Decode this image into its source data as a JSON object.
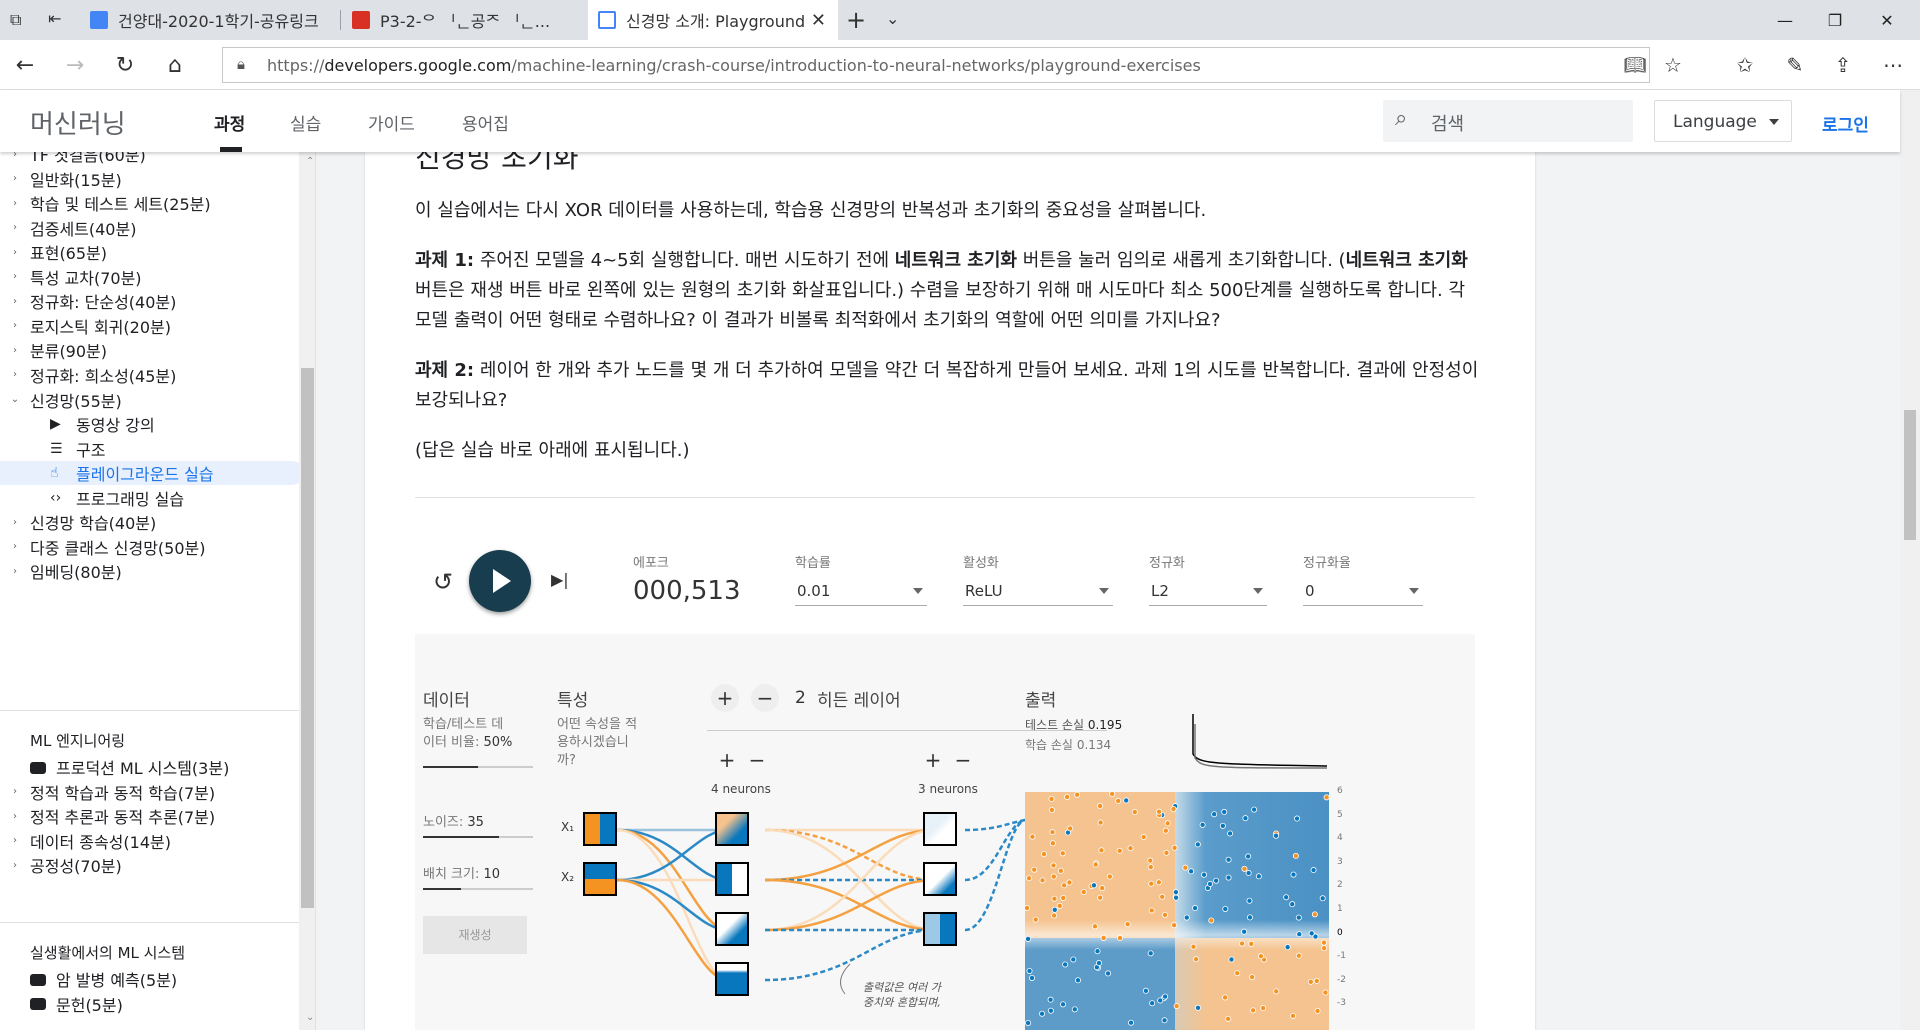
{
  "browser": {
    "tabs": [
      {
        "title": "건양대-2020-1학기-공유링크",
        "icon": "google-docs-icon"
      },
      {
        "title": "P3-2-ᄋ ᅵᆫ공ᄌ ᅵᆫ...",
        "icon": "pdf-icon"
      },
      {
        "title": "신경망 소개: Playground",
        "icon": "developers-icon"
      }
    ],
    "url_prefix": "https://",
    "url_host": "developers.google.com",
    "url_path": "/machine-learning/crash-course/introduction-to-neural-networks/playground-exercises"
  },
  "site": {
    "title": "머신러닝",
    "nav": [
      "과정",
      "실습",
      "가이드",
      "용어집"
    ],
    "search_placeholder": "검색",
    "language": "Language",
    "login": "로그인"
  },
  "sidebar": {
    "items": [
      {
        "label": "TF 첫걸음(60분)",
        "type": "collapsed"
      },
      {
        "label": "일반화(15분)",
        "type": "collapsed"
      },
      {
        "label": "학습 및 테스트 세트(25분)",
        "type": "collapsed"
      },
      {
        "label": "검증세트(40분)",
        "type": "collapsed"
      },
      {
        "label": "표현(65분)",
        "type": "collapsed"
      },
      {
        "label": "특성 교차(70분)",
        "type": "collapsed"
      },
      {
        "label": "정규화: 단순성(40분)",
        "type": "collapsed"
      },
      {
        "label": "로지스틱 회귀(20분)",
        "type": "collapsed"
      },
      {
        "label": "분류(90분)",
        "type": "collapsed"
      },
      {
        "label": "정규화: 희소성(45분)",
        "type": "collapsed"
      },
      {
        "label": "신경망(55분)",
        "type": "expanded"
      },
      {
        "label": "동영상 강의",
        "type": "sub",
        "icon": "youtube-icon"
      },
      {
        "label": "구조",
        "type": "sub",
        "icon": "list-icon"
      },
      {
        "label": "플레이그라운드 실습",
        "type": "sub-active",
        "icon": "touch-icon"
      },
      {
        "label": "프로그래밍 실습",
        "type": "sub",
        "icon": "code-icon"
      },
      {
        "label": "신경망 학습(40분)",
        "type": "collapsed"
      },
      {
        "label": "다중 클래스 신경망(50분)",
        "type": "collapsed"
      },
      {
        "label": "임베딩(80분)",
        "type": "collapsed"
      }
    ],
    "section2_title": "ML 엔지니어링",
    "section2_items": [
      {
        "label": "프로덕션 ML 시스템(3분)",
        "type": "video"
      },
      {
        "label": "정적 학습과 동적 학습(7분)",
        "type": "collapsed"
      },
      {
        "label": "정적 추론과 동적 추론(7분)",
        "type": "collapsed"
      },
      {
        "label": "데이터 종속성(14분)",
        "type": "collapsed"
      },
      {
        "label": "공정성(70분)",
        "type": "collapsed"
      }
    ],
    "section3_title": "실생활에서의 ML 시스템",
    "section3_items": [
      {
        "label": "암 발병 예측(5분)",
        "type": "video"
      },
      {
        "label": "문헌(5분)",
        "type": "video"
      }
    ]
  },
  "content": {
    "heading_partial": "신경망 초기화",
    "intro": "이 실습에서는 다시 XOR 데이터를 사용하는데, 학습용 신경망의 반복성과 초기화의 중요성을 살펴봅니다.",
    "task1_label": "과제 1:",
    "task1_a": " 주어진 모델을 4~5회 실행합니다. 매번 시도하기 전에 ",
    "task1_b": "네트워크 초기화",
    "task1_c": " 버튼을 눌러 임의로 새롭게 초기화합니다. (",
    "task1_d": "네트워크 초기화",
    "task1_e": " 버튼은 재생 버튼 바로 왼쪽에 있는 원형의 초기화 화살표입니다.) 수렴을 보장하기 위해 매 시도마다 최소 500단계를 실행하도록 합니다. 각 모델 출력이 어떤 형태로 수렴하나요? 이 결과가 비볼록 최적화에서 초기화의 역할에 어떤 의미를 가지나요?",
    "task2_label": "과제 2:",
    "task2_text": " 레이어 한 개와 추가 노드를 몇 개 더 추가하여 모델을 약간 더 복잡하게 만들어 보세요. 과제 1의 시도를 반복합니다. 결과에 안정성이 보강되나요?",
    "answer_note": "(답은 실습 바로 아래에 표시됩니다.)"
  },
  "playground": {
    "epoch_label": "에포크",
    "epoch_value": "000,513",
    "lr_label": "학습률",
    "lr_value": "0.01",
    "activation_label": "활성화",
    "activation_value": "ReLU",
    "reg_label": "정규화",
    "reg_value": "L2",
    "regrate_label": "정규화율",
    "regrate_value": "0",
    "data_title": "데이터",
    "ratio_label_a": "학습/테스트 데",
    "ratio_label_b": "이터 비율:",
    "ratio_value": "50%",
    "ratio_fraction": 0.5,
    "noise_label": "노이즈:",
    "noise_value": "35",
    "batch_label": "배치 크기:",
    "batch_value": "10",
    "regen_label": "재생성",
    "features_title": "특성",
    "features_q": [
      "어떤 속성을 적",
      "용하시겠습니",
      "까?"
    ],
    "hidden_count": "2",
    "hidden_label": "히든 레이어",
    "layer1_neurons": "4 neurons",
    "layer2_neurons": "3 neurons",
    "x1": "X₁",
    "x2": "X₂",
    "output_title": "출력",
    "test_loss_label": "테스트 손실",
    "test_loss": "0.195",
    "train_loss_label": "학습 손실",
    "train_loss": "0.134",
    "annotation": [
      "출력값은 여러 가",
      "중치와 혼합되며,"
    ],
    "axis_ticks": [
      "6",
      "5",
      "4",
      "3",
      "2",
      "1",
      "0",
      "-1",
      "-2",
      "-3"
    ],
    "colors": {
      "orange": "#f59322",
      "blue": "#0877bd"
    }
  }
}
